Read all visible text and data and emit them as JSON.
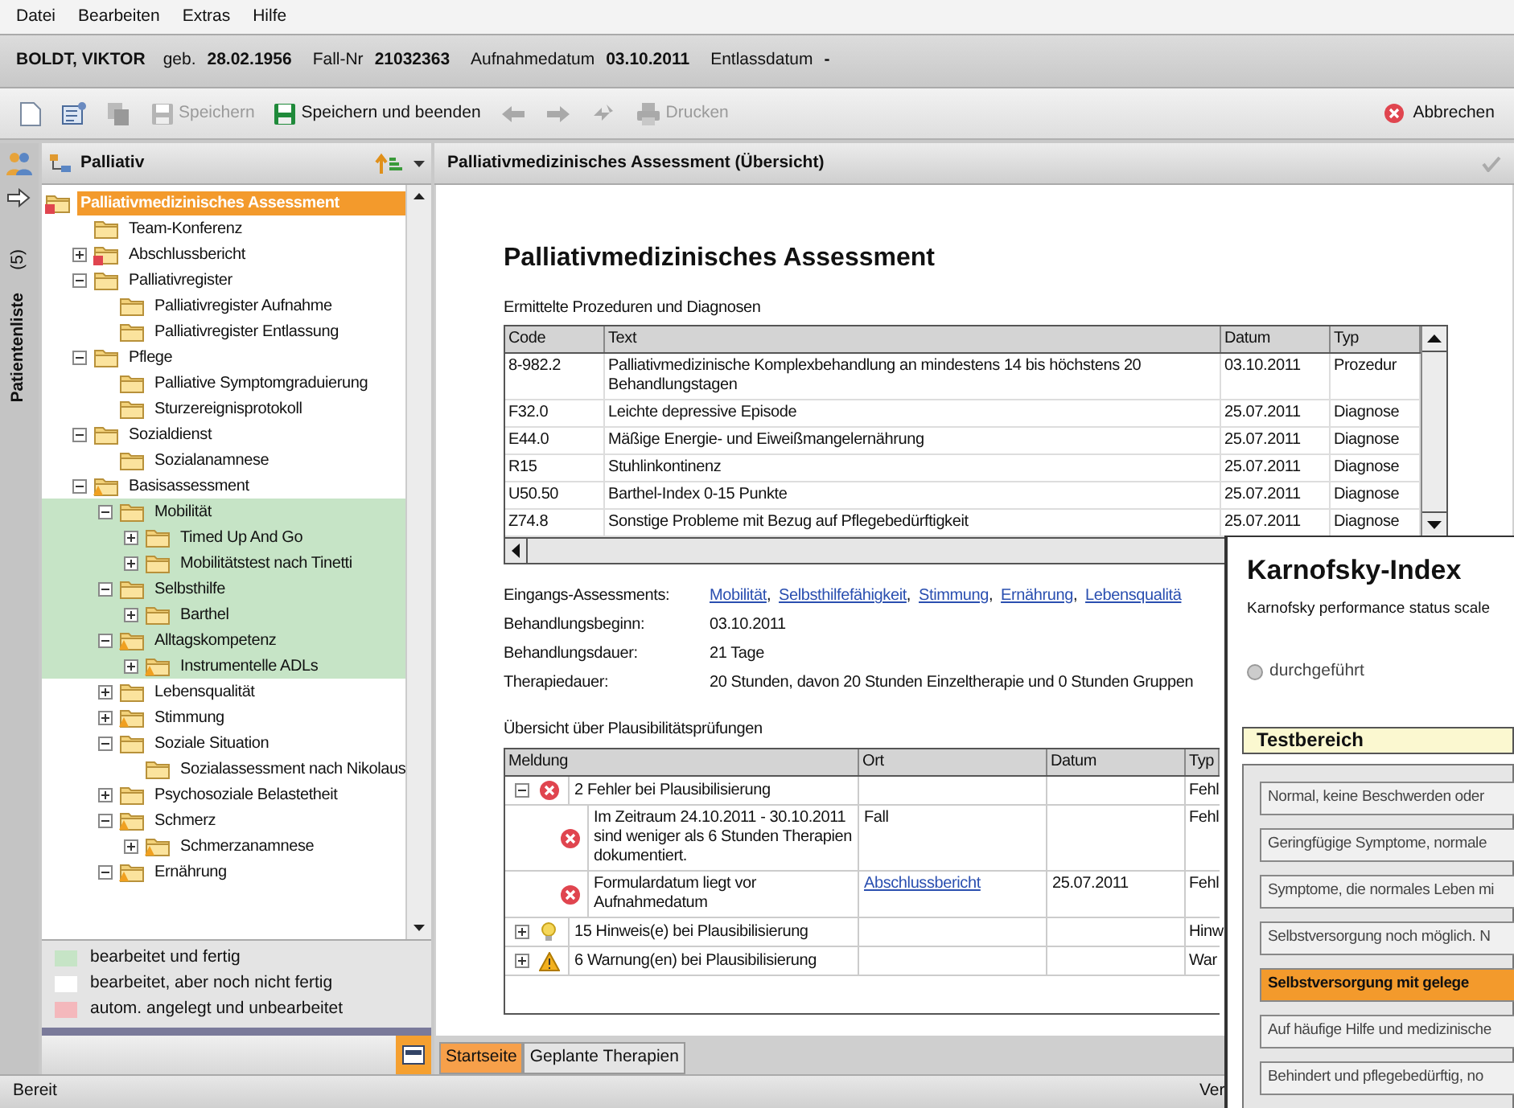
{
  "menu": [
    "Datei",
    "Bearbeiten",
    "Extras",
    "Hilfe"
  ],
  "patient": {
    "name": "BOLDT, VIKTOR",
    "fields": [
      {
        "label": "geb.",
        "value": "28.02.1956"
      },
      {
        "label": "Fall-Nr",
        "value": "21032363"
      },
      {
        "label": "Aufnahmedatum",
        "value": "03.10.2011"
      },
      {
        "label": "Entlassdatum",
        "value": "-"
      }
    ]
  },
  "toolbar": {
    "items": [
      {
        "kind": "new",
        "disabled": false
      },
      {
        "kind": "form",
        "disabled": false
      },
      {
        "kind": "copy",
        "disabled": true
      },
      {
        "kind": "save",
        "label": "Speichern",
        "disabled": true
      },
      {
        "kind": "save",
        "label": "Speichern und beenden",
        "disabled": false
      },
      {
        "kind": "back",
        "disabled": true
      },
      {
        "kind": "forward",
        "disabled": true
      },
      {
        "kind": "sync",
        "disabled": true
      },
      {
        "kind": "print",
        "label": "Drucken",
        "disabled": true
      }
    ],
    "cancel": "Abbrechen"
  },
  "sidebar": {
    "tab": "Patientenliste",
    "count": "(5)",
    "title": "Palliativ",
    "tree": [
      {
        "label": "Palliativmedizinisches Assessment",
        "selected": true,
        "done": false,
        "kind": "error",
        "children": [
          {
            "label": "Team-Konferenz",
            "selected": false,
            "done": false,
            "kind": "plain"
          },
          {
            "label": "Abschlussbericht",
            "selected": false,
            "done": false,
            "kind": "error",
            "expanded": false
          },
          {
            "label": "Palliativregister",
            "selected": false,
            "done": false,
            "kind": "plain",
            "expanded": true,
            "children": [
              {
                "label": "Palliativregister Aufnahme",
                "selected": false,
                "done": false,
                "kind": "plain"
              },
              {
                "label": "Palliativregister Entlassung",
                "selected": false,
                "done": false,
                "kind": "plain"
              }
            ]
          },
          {
            "label": "Pflege",
            "selected": false,
            "done": false,
            "kind": "plain",
            "expanded": true,
            "children": [
              {
                "label": "Palliative Symptomgraduierung",
                "selected": false,
                "done": false,
                "kind": "plain"
              },
              {
                "label": "Sturzereignisprotokoll",
                "selected": false,
                "done": false,
                "kind": "plain"
              }
            ]
          },
          {
            "label": "Sozialdienst",
            "selected": false,
            "done": false,
            "kind": "plain",
            "expanded": true,
            "children": [
              {
                "label": "Sozialanamnese",
                "selected": false,
                "done": false,
                "kind": "plain"
              }
            ]
          },
          {
            "label": "Basisassessment",
            "selected": false,
            "done": false,
            "kind": "warning",
            "expanded": true,
            "children": [
              {
                "label": "Mobilität",
                "selected": false,
                "done": true,
                "kind": "plain",
                "expanded": true,
                "children": [
                  {
                    "label": "Timed Up And Go",
                    "selected": false,
                    "done": true,
                    "kind": "plain",
                    "expanded": false
                  },
                  {
                    "label": "Mobilitätstest nach Tinetti",
                    "selected": false,
                    "done": true,
                    "kind": "plain",
                    "expanded": false
                  }
                ]
              },
              {
                "label": "Selbsthilfe",
                "selected": false,
                "done": true,
                "kind": "plain",
                "expanded": true,
                "children": [
                  {
                    "label": "Barthel",
                    "selected": false,
                    "done": true,
                    "kind": "plain",
                    "expanded": false
                  }
                ]
              },
              {
                "label": "Alltagskompetenz",
                "selected": false,
                "done": true,
                "kind": "warning",
                "expanded": true,
                "children": [
                  {
                    "label": "Instrumentelle ADLs",
                    "selected": false,
                    "done": true,
                    "kind": "warning",
                    "expanded": false
                  }
                ]
              },
              {
                "label": "Lebensqualität",
                "selected": false,
                "done": false,
                "kind": "plain",
                "expanded": false
              },
              {
                "label": "Stimmung",
                "selected": false,
                "done": false,
                "kind": "warning",
                "expanded": false
              },
              {
                "label": "Soziale Situation",
                "selected": false,
                "done": false,
                "kind": "plain",
                "expanded": true,
                "children": [
                  {
                    "label": "Sozialassessment nach Nikolaus",
                    "selected": false,
                    "done": false,
                    "kind": "plain"
                  }
                ]
              },
              {
                "label": "Psychosoziale Belastetheit",
                "selected": false,
                "done": false,
                "kind": "plain",
                "expanded": false
              },
              {
                "label": "Schmerz",
                "selected": false,
                "done": false,
                "kind": "warning",
                "expanded": true,
                "children": [
                  {
                    "label": "Schmerzanamnese",
                    "selected": false,
                    "done": false,
                    "kind": "warning",
                    "expanded": false
                  }
                ]
              },
              {
                "label": "Ernährung",
                "selected": false,
                "done": false,
                "kind": "warning",
                "expanded": true
              }
            ]
          }
        ]
      }
    ],
    "legend": [
      {
        "label": "bearbeitet und fertig",
        "color": "#c6e4c6"
      },
      {
        "label": "bearbeitet, aber noch nicht fertig",
        "color": "#ffffff"
      },
      {
        "label": "autom. angelegt und unbearbeitet",
        "color": "#f4b8bc"
      }
    ]
  },
  "content": {
    "header": "Palliativmedizinisches Assessment (Übersicht)",
    "title": "Palliativmedizinisches Assessment",
    "table_caption": "Ermittelte Prozeduren und Diagnosen",
    "table": {
      "columns": [
        "Code",
        "Text",
        "Datum",
        "Typ"
      ],
      "rows": [
        [
          "8-982.2",
          "Palliativmedizinische Komplexbehandlung an mindestens 14 bis höchstens 20 Behandlungstagen",
          "03.10.2011",
          "Prozedur"
        ],
        [
          "F32.0",
          "Leichte depressive Episode",
          "25.07.2011",
          "Diagnose"
        ],
        [
          "E44.0",
          "Mäßige Energie- und Eiweißmangelernährung",
          "25.07.2011",
          "Diagnose"
        ],
        [
          "R15",
          "Stuhlinkontinenz",
          "25.07.2011",
          "Diagnose"
        ],
        [
          "U50.50",
          "Barthel-Index 0-15 Punkte",
          "25.07.2011",
          "Diagnose"
        ],
        [
          "Z74.8",
          "Sonstige Probleme mit Bezug auf Pflegebedürftigkeit",
          "25.07.2011",
          "Diagnose"
        ]
      ]
    },
    "info": [
      {
        "label": "Eingangs-Assessments:",
        "links": [
          "Mobilität",
          "Selbsthilfefähigkeit",
          "Stimmung",
          "Ernährung",
          "Lebensqualitä"
        ],
        "separator": ","
      },
      {
        "label": "Behandlungsbeginn:",
        "value": "03.10.2011"
      },
      {
        "label": "Behandlungsdauer:",
        "value": "21 Tage"
      },
      {
        "label": "Therapiedauer:",
        "value": "20 Stunden, davon 20 Stunden Einzeltherapie und 0 Stunden Gruppen"
      }
    ],
    "checks_caption": "Übersicht über Plausibilitätsprüfungen",
    "checks": {
      "columns": [
        "Meldung",
        "Ort",
        "Datum",
        "Typ"
      ],
      "rows": [
        {
          "kind": "error",
          "expanded": true,
          "message": "2 Fehler bei Plausibilisierung",
          "typ": "Fehl",
          "children": [
            {
              "kind": "error",
              "message": "Im Zeitraum 24.10.2011 - 30.10.2011 sind weniger als 6 Stunden Therapien dokumentiert.",
              "ort": "Fall",
              "ort_link": false,
              "typ": "Fehl"
            },
            {
              "kind": "error",
              "message": "Formulardatum liegt vor Aufnahmedatum",
              "ort": "Abschlussbericht",
              "ort_link": true,
              "datum": "25.07.2011",
              "typ": "Fehl"
            }
          ]
        },
        {
          "kind": "hint",
          "expanded": false,
          "message": "15 Hinweis(e) bei Plausibilisierung",
          "typ": "Hinw"
        },
        {
          "kind": "warning",
          "expanded": false,
          "message": "6 Warnung(en) bei Plausibilisierung",
          "typ": "War"
        }
      ]
    },
    "tabs": [
      {
        "label": "Startseite",
        "selected": true
      },
      {
        "label": "Geplante Therapien",
        "selected": false
      }
    ]
  },
  "status_bar": [
    "Bereit",
    "Ver"
  ],
  "dialog": {
    "title": "Karnofsky-Index",
    "subtitle": "Karnofsky performance status scale",
    "radio": {
      "label": "durchgeführt",
      "checked": false
    },
    "section": "Testbereich",
    "options": [
      {
        "label": "Normal, keine Beschwerden oder",
        "selected": false
      },
      {
        "label": "Geringfügige Symptome, normale",
        "selected": false
      },
      {
        "label": "Symptome, die normales Leben mi",
        "selected": false
      },
      {
        "label": "Selbstversorgung noch möglich. N",
        "selected": false
      },
      {
        "label": "Selbstversorgung mit gelege",
        "selected": true
      },
      {
        "label": "Auf häufige Hilfe und medizinische",
        "selected": false
      },
      {
        "label": "Behindert und pflegebedürftig, no",
        "selected": false
      }
    ]
  }
}
